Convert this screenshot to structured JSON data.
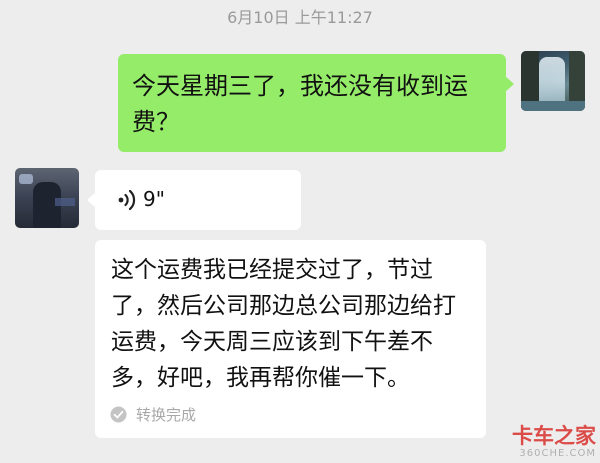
{
  "timestamp": "6月10日 上午11:27",
  "messages": [
    {
      "side": "right",
      "type": "text",
      "text": "今天星期三了，我还没有收到运费？",
      "bubble_color": "#95ec69",
      "avatar": "waterfall-avatar"
    },
    {
      "side": "left",
      "type": "voice",
      "duration": "9\"",
      "bubble_color": "#ffffff",
      "avatar": "person-avatar"
    },
    {
      "side": "left",
      "type": "transcription",
      "text": "这个运费我已经提交过了，节过了，然后公司那边总公司那边给打运费，今天周三应该到下午差不多，好吧，我再帮你催一下。",
      "status": "转换完成",
      "status_icon": "check-circle-icon"
    }
  ],
  "watermark": {
    "main": "卡车之家",
    "sub": "360CHE.COM"
  },
  "colors": {
    "background": "#ededed",
    "sent_bubble": "#95ec69",
    "received_bubble": "#ffffff",
    "timestamp_text": "#9a9a9a",
    "watermark": "#d9312c"
  }
}
